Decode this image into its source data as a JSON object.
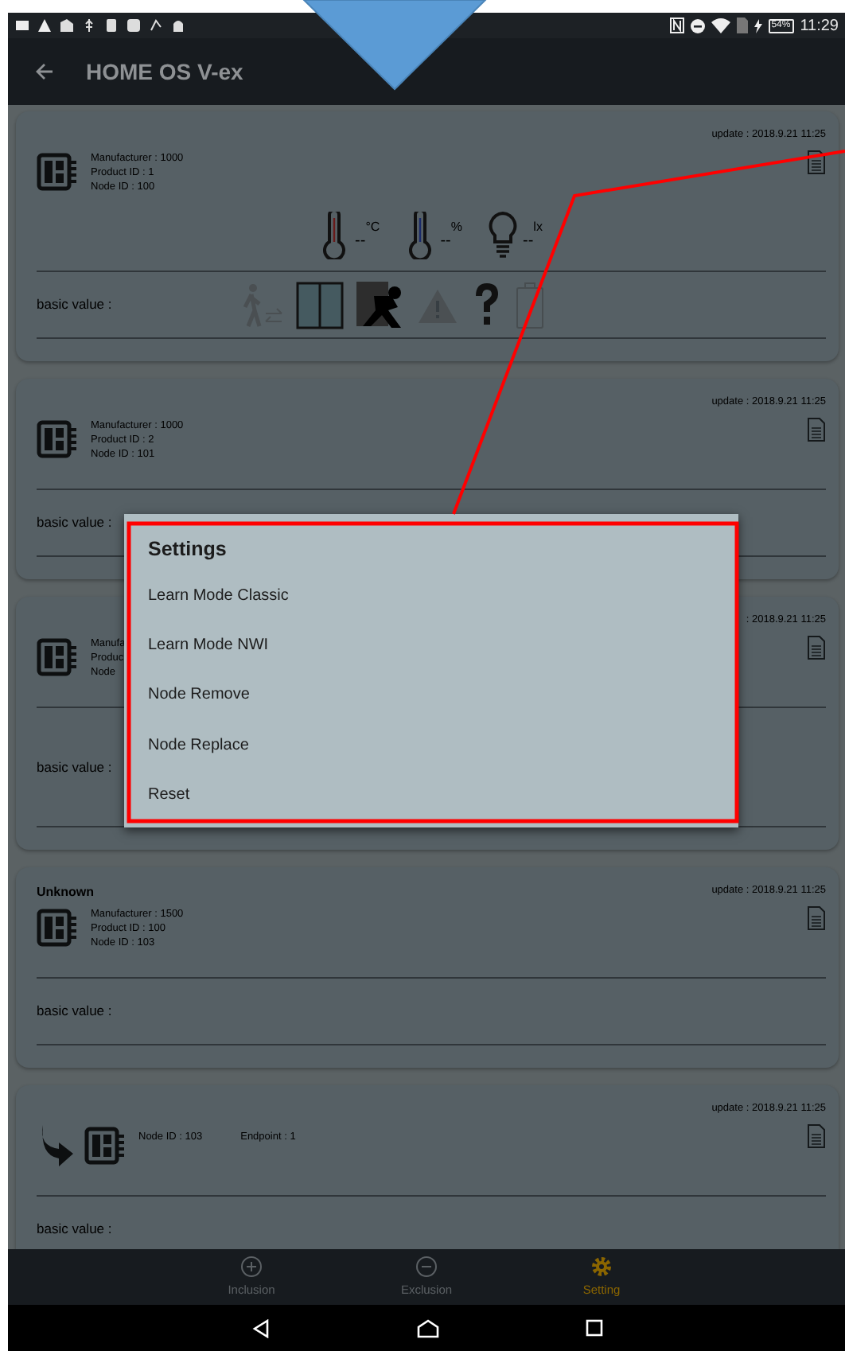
{
  "status_bar": {
    "battery": "54%",
    "time": "11:29"
  },
  "app_bar": {
    "title": "HOME OS V-ex"
  },
  "devices": [
    {
      "kind": "device",
      "update": "update : 2018.9.21 11:25",
      "info": [
        "Manufacturer : 1000",
        "Product ID : 1",
        "Node ID : 100"
      ],
      "sensors": [
        {
          "kind": "temperature",
          "value": "--",
          "unit": "°C"
        },
        {
          "kind": "humidity",
          "value": "--",
          "unit": "%"
        },
        {
          "kind": "light",
          "value": "--",
          "unit": "lx"
        }
      ],
      "basic_value": "basic value :",
      "status_icons": true
    },
    {
      "kind": "device",
      "update": "update : 2018.9.21 11:25",
      "info": [
        "Manufacturer : 1000",
        "Product ID : 2",
        "Node ID : 101"
      ],
      "basic_value": "basic value :"
    },
    {
      "kind": "device",
      "update": ": 2018.9.21 11:25",
      "info": [
        "Manufa",
        "Produc",
        "Node"
      ],
      "basic_value": "basic value :"
    },
    {
      "kind": "device",
      "name": "Unknown",
      "update": "update : 2018.9.21 11:25",
      "info": [
        "Manufacturer : 1500",
        "Product ID : 100",
        "Node ID : 103"
      ],
      "basic_value": "basic value :"
    },
    {
      "kind": "endpoint",
      "update": "update : 2018.9.21 11:25",
      "info": [
        "Node ID : 103",
        "Endpoint : 1"
      ],
      "basic_value": "basic value :"
    }
  ],
  "bottom_nav": [
    {
      "kind": "inclusion",
      "label": "Inclusion",
      "selected": false
    },
    {
      "kind": "exclusion",
      "label": "Exclusion",
      "selected": false
    },
    {
      "kind": "setting",
      "label": "Setting",
      "selected": true
    }
  ],
  "dialog": {
    "title": "Settings",
    "items": [
      "Learn Mode Classic",
      "Learn Mode NWI",
      "Node Remove",
      "Node Replace",
      "Reset"
    ]
  }
}
